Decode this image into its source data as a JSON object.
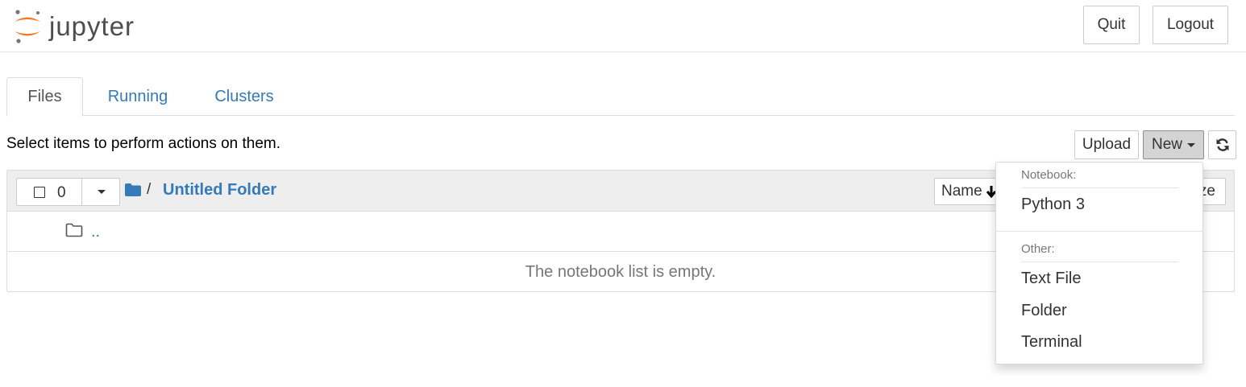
{
  "header": {
    "logo_text": "jupyter",
    "quit_label": "Quit",
    "logout_label": "Logout",
    "brand_orange": "#f37726"
  },
  "tabs": [
    {
      "label": "Files",
      "active": true
    },
    {
      "label": "Running",
      "active": false
    },
    {
      "label": "Clusters",
      "active": false
    }
  ],
  "toolbar": {
    "hint": "Select items to perform actions on them.",
    "upload_label": "Upload",
    "new_label": "New",
    "refresh_icon": "refresh-icon"
  },
  "file_list": {
    "selected_count": "0",
    "breadcrumb_separator": "/",
    "current_folder": "Untitled Folder",
    "sort_name_label": "Name",
    "sort_size_label": "ze",
    "parent_link": "..",
    "empty_message": "The notebook list is empty."
  },
  "new_menu": {
    "notebook_header": "Notebook:",
    "notebook_items": [
      "Python 3"
    ],
    "other_header": "Other:",
    "other_items": [
      "Text File",
      "Folder",
      "Terminal"
    ]
  },
  "colors": {
    "link": "#337ab7",
    "active_button_bg": "#d4d4d4"
  }
}
